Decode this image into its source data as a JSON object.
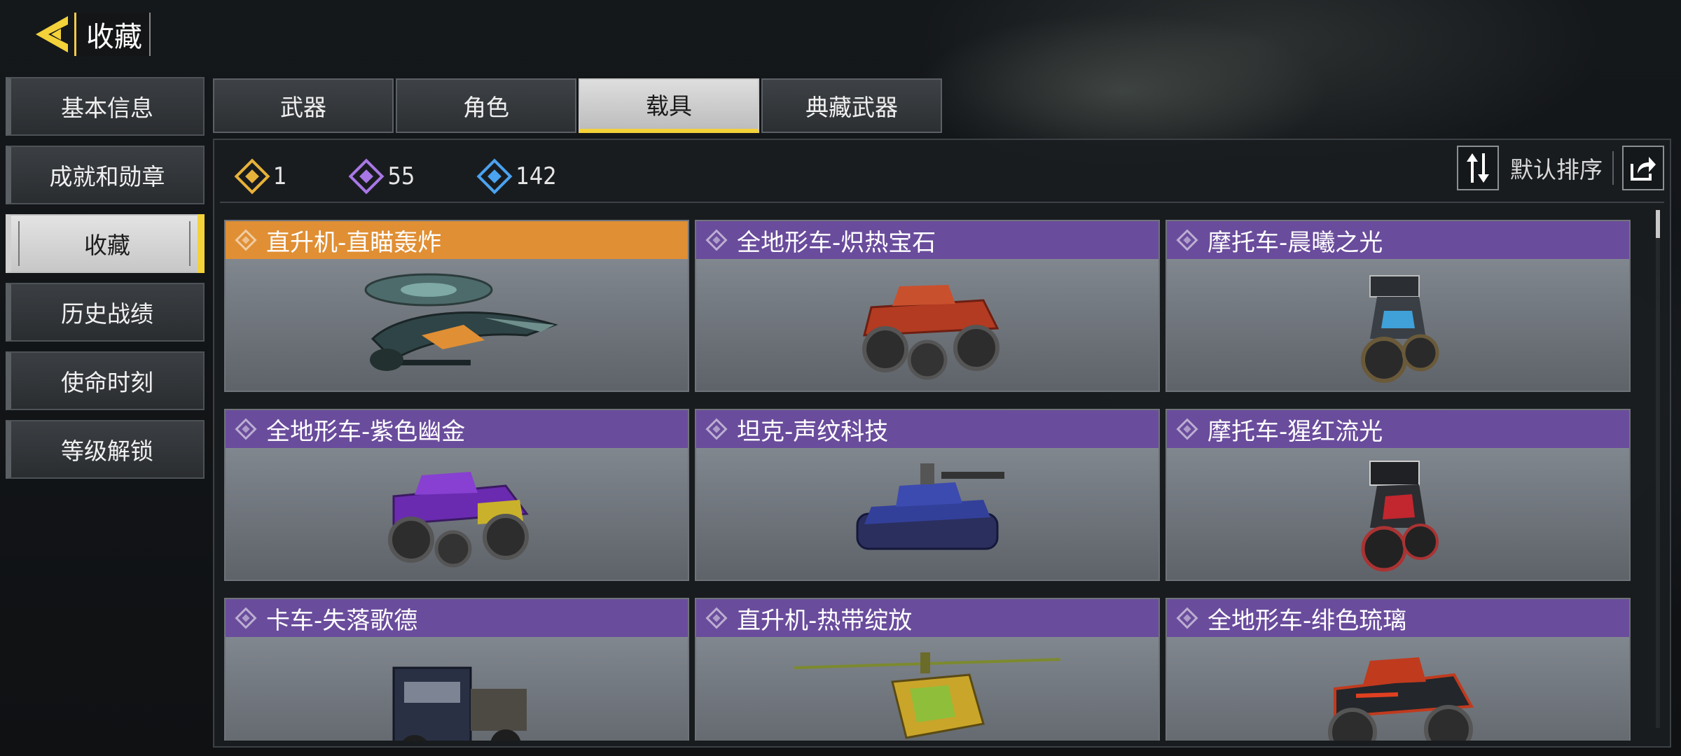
{
  "header": {
    "title": "收藏"
  },
  "sidebar": {
    "items": [
      {
        "label": "基本信息"
      },
      {
        "label": "成就和勋章"
      },
      {
        "label": "收藏",
        "active": true
      },
      {
        "label": "历史战绩"
      },
      {
        "label": "使命时刻"
      },
      {
        "label": "等级解锁"
      }
    ]
  },
  "tabs": [
    {
      "label": "武器"
    },
    {
      "label": "角色"
    },
    {
      "label": "载具",
      "active": true
    },
    {
      "label": "典藏武器"
    }
  ],
  "stats": {
    "gold_count": "1",
    "purple_count": "55",
    "blue_count": "142"
  },
  "sort": {
    "label": "默认排序"
  },
  "colors": {
    "accent": "#f3d23a",
    "gold": "#e08f34",
    "purple": "#6a4c9c",
    "blue": "#4aa3f0"
  },
  "items": [
    {
      "name": "直升机-直瞄轰炸",
      "rarity": "gold",
      "icon": "helicopter-icon"
    },
    {
      "name": "全地形车-炽热宝石",
      "rarity": "purple",
      "icon": "atv-icon"
    },
    {
      "name": "摩托车-晨曦之光",
      "rarity": "purple",
      "icon": "motorcycle-icon"
    },
    {
      "name": "全地形车-紫色幽金",
      "rarity": "purple",
      "icon": "atv-icon"
    },
    {
      "name": "坦克-声纹科技",
      "rarity": "purple",
      "icon": "tank-icon"
    },
    {
      "name": "摩托车-猩红流光",
      "rarity": "purple",
      "icon": "motorcycle-icon"
    },
    {
      "name": "卡车-失落歌德",
      "rarity": "purple",
      "icon": "truck-icon"
    },
    {
      "name": "直升机-热带绽放",
      "rarity": "purple",
      "icon": "helicopter-icon"
    },
    {
      "name": "全地形车-绯色琉璃",
      "rarity": "purple",
      "icon": "atv-icon"
    }
  ]
}
